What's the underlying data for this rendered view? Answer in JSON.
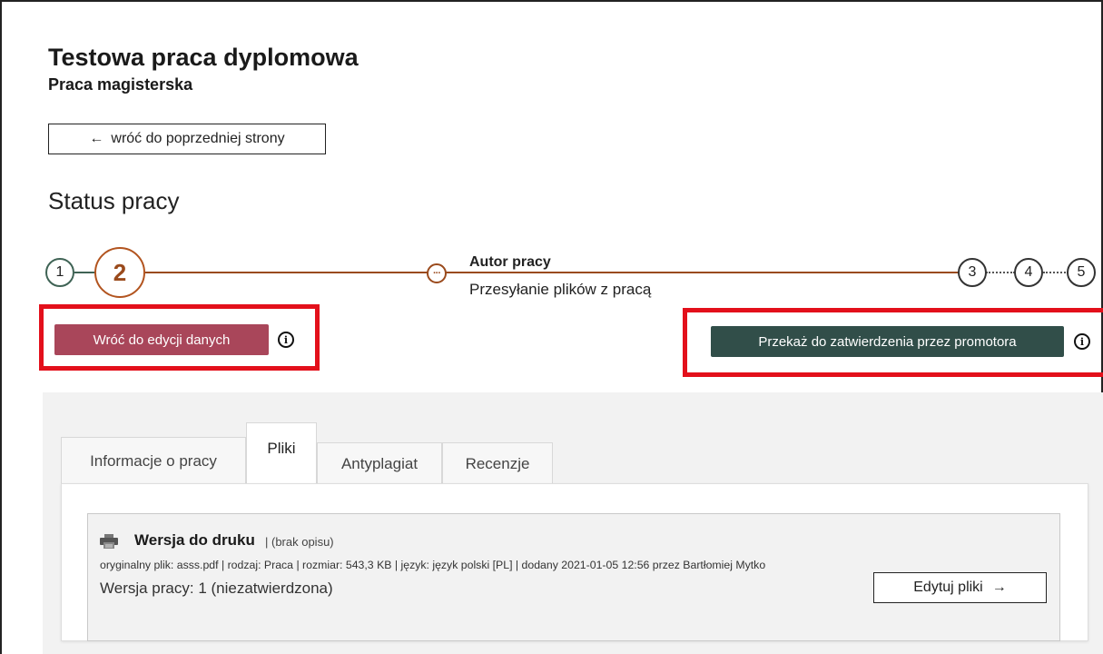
{
  "header": {
    "title": "Testowa praca dyplomowa",
    "subtitle": "Praca magisterska"
  },
  "back_button": {
    "arrow": "←",
    "label": "wróć do poprzedniej strony"
  },
  "status": {
    "section_title": "Status pracy",
    "steps": {
      "step1": "1",
      "step2": "2",
      "current_marker": "···",
      "step3": "3",
      "step4": "4",
      "step5": "5"
    },
    "current_step_role": "Autor pracy",
    "current_step_desc": "Przesyłanie plików z pracą"
  },
  "actions": {
    "back_to_edit_label": "Wróć do edycji danych",
    "submit_label": "Przekaż do zatwierdzenia przez promotora",
    "info_glyph": "i"
  },
  "tabs": [
    {
      "label": "Informacje o pracy"
    },
    {
      "label": "Pliki"
    },
    {
      "label": "Antyplagiat"
    },
    {
      "label": "Recenzje"
    }
  ],
  "active_tab_index": 1,
  "file": {
    "title": "Wersja do druku",
    "description": "| (brak opisu)",
    "meta": "oryginalny plik: asss.pdf | rodzaj: Praca | rozmiar: 543,3 KB | język: język polski [PL] | dodany 2021-01-05 12:56 przez Bartłomiej Mytko",
    "version": "Wersja pracy: 1 (niezatwierdzona)",
    "edit_label": "Edytuj pliki",
    "edit_arrow": "→",
    "icon": "printer-icon"
  },
  "colors": {
    "accent_step": "#9a4a1c",
    "btn_back": "#a9465a",
    "btn_submit": "#314e49",
    "highlight": "#e3101b"
  }
}
